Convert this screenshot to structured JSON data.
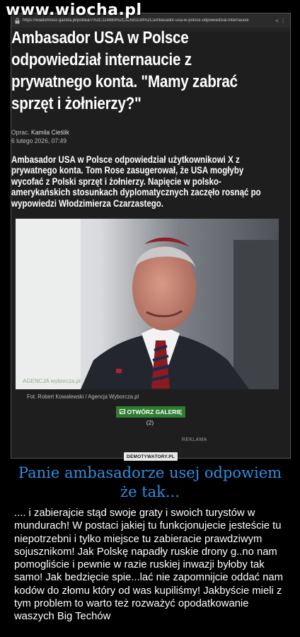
{
  "watermark": "www.wiocha.pl",
  "browser": {
    "url": "https://wiadomosci.gazeta.pl/polska/7%2C114883%2C32581139%2Cambasador-usa-w-polsce-odpowiedzial-internaucie"
  },
  "article": {
    "headline": "Ambasador USA w Polsce odpowiedział internaucie z prywatnego konta. \"Mamy zabrać sprzęt i żołnierzy?\"",
    "author_prefix": "Oprac.",
    "author": "Kamila Cieślik",
    "date": "6 lutego 2026, 07:49",
    "lead": "Ambasador USA w Polsce odpowiedział użytkownikowi X z prywatnego konta. Tom Rose zasugerował, że USA mogłyby wycofać z Polski sprzęt i żołnierzy. Napięcie w polsko-amerykańskich stosunkach dyplomatycznych zaczęło rosnąć po wypowiedzi Włodzimierza Czarzastego.",
    "photo_watermark": "AGENCJA wyborcza.pl",
    "photo_credit": "Fot. Robert Kowalewski / Agencja Wyborcza.pl",
    "gallery_button": "OTWÓRZ GALERIĘ",
    "gallery_count": "(2)",
    "ad_label": "REKLAMA"
  },
  "demotywatory_badge": "DEMOTYWATORY.PL",
  "post": {
    "title": "Panie ambasadorze usej odpowiem że tak...",
    "body": ".... i zabierajcie stąd swoje graty i swoich turystów w mundurach! W postaci jakiej tu funkcjonujecie jesteście tu niepotrzebni  i tylko miejsce tu zabieracie prawdziwym sojusznikom! Jak Polskę napadły ruskie drony g..no nam pomogliście i pewnie w razie ruskiej inwazji byłoby tak samo! Jak bedzięcie spie...lać nie zapomnijcie  oddać nam kodów do złomu który od was kupiliśmy! Jakbyście mieli z tym problem to warto też rozważyć opodatkowanie waszych Big Techów"
  },
  "colors": {
    "title_blue": "#2f8fe0",
    "gallery_green": "#2e7d32"
  }
}
